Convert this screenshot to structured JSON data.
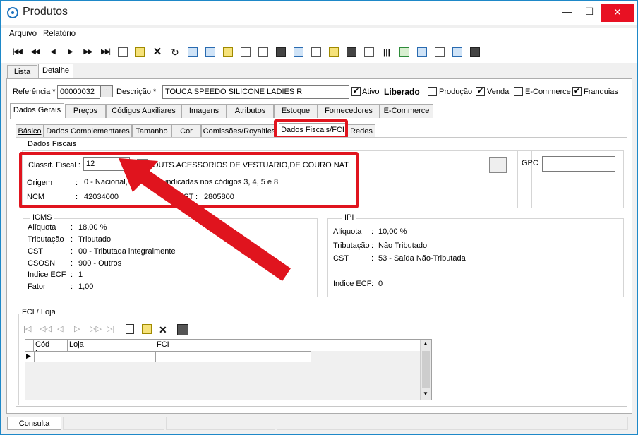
{
  "window": {
    "title": "Produtos",
    "min": "—",
    "max": "☐",
    "close": "✕"
  },
  "menu": [
    "Arquivo",
    "Relatório"
  ],
  "toolbar": {
    "nav": [
      "|◀◀",
      "◀◀",
      "◀",
      "▶",
      "▶▶",
      "▶▶|"
    ]
  },
  "main_tabs": [
    "Lista",
    "Detalhe"
  ],
  "form": {
    "referencia_label": "Referência *",
    "referencia_value": "00000032",
    "lookup": "···",
    "descricao_label": "Descrição *",
    "descricao_value": "TOUCA SPEEDO SILICONE LADIES R",
    "ativo_label": "Ativo",
    "ativo_checked": "✔",
    "status": "Liberado",
    "producao_label": "Produção",
    "producao_checked": "",
    "venda_label": "Venda",
    "venda_checked": "✔",
    "ecommerce_label": "E-Commerce",
    "ecommerce_checked": "",
    "franquias_label": "Franquias",
    "franquias_checked": "✔"
  },
  "section_tabs": [
    "Dados Gerais",
    "Preços",
    "Códigos Auxiliares",
    "Imagens",
    "Atributos",
    "Estoque",
    "Fornecedores",
    "E-Commerce"
  ],
  "sub_tabs": [
    "Básico",
    "Dados Complementares",
    "Tamanho",
    "Cor",
    "Comissões/Royalties",
    "Dados Fiscais/FCI",
    "Redes"
  ],
  "dados_fiscais": {
    "title": "Dados Fiscais",
    "classif_label": "Classif. Fiscal :",
    "classif_value": "12",
    "classif_desc": "OUTS.ACESSORIOS DE VESTUARIO,DE COURO NAT",
    "origem_label": "Origem",
    "origem_sep": ":",
    "origem_value": "0 - Nacional, exceto as indicadas nos códigos 3, 4, 5 e 8",
    "ncm_label": "NCM",
    "ncm_sep": ":",
    "ncm_value": "42034000",
    "cest_label": "CEST",
    "cest_sep": ":",
    "cest_value": "2805800",
    "gpc_label": "GPC",
    "gpc_value": ""
  },
  "icms": {
    "title": "ICMS",
    "rows": [
      {
        "label": "Alíquota",
        "sep": ":",
        "value": "18,00 %"
      },
      {
        "label": "Tributação",
        "sep": ":",
        "value": "Tributado"
      },
      {
        "label": "CST",
        "sep": ":",
        "value": "00 - Tributada integralmente"
      },
      {
        "label": "CSOSN",
        "sep": ":",
        "value": "900 - Outros"
      },
      {
        "label": "Indice ECF",
        "sep": ":",
        "value": "1"
      },
      {
        "label": "Fator",
        "sep": ":",
        "value": "1,00"
      }
    ]
  },
  "ipi": {
    "title": "IPI",
    "rows": [
      {
        "label": "Alíquota",
        "sep": ":",
        "value": "10,00 %"
      },
      {
        "label": "Tributação",
        "sep": ":",
        "value": "Não Tributado"
      },
      {
        "label": "CST",
        "sep": ":",
        "value": "53 - Saída Não-Tributada"
      },
      {
        "label": "Indice ECF",
        "sep": ":",
        "value": "0"
      }
    ]
  },
  "fci": {
    "title": "FCI / Loja",
    "columns": [
      "Cód Loja",
      "Loja",
      "FCI"
    ],
    "row_indicator": "▶"
  },
  "status": {
    "tab": "Consulta"
  },
  "accent": "#e0141e"
}
